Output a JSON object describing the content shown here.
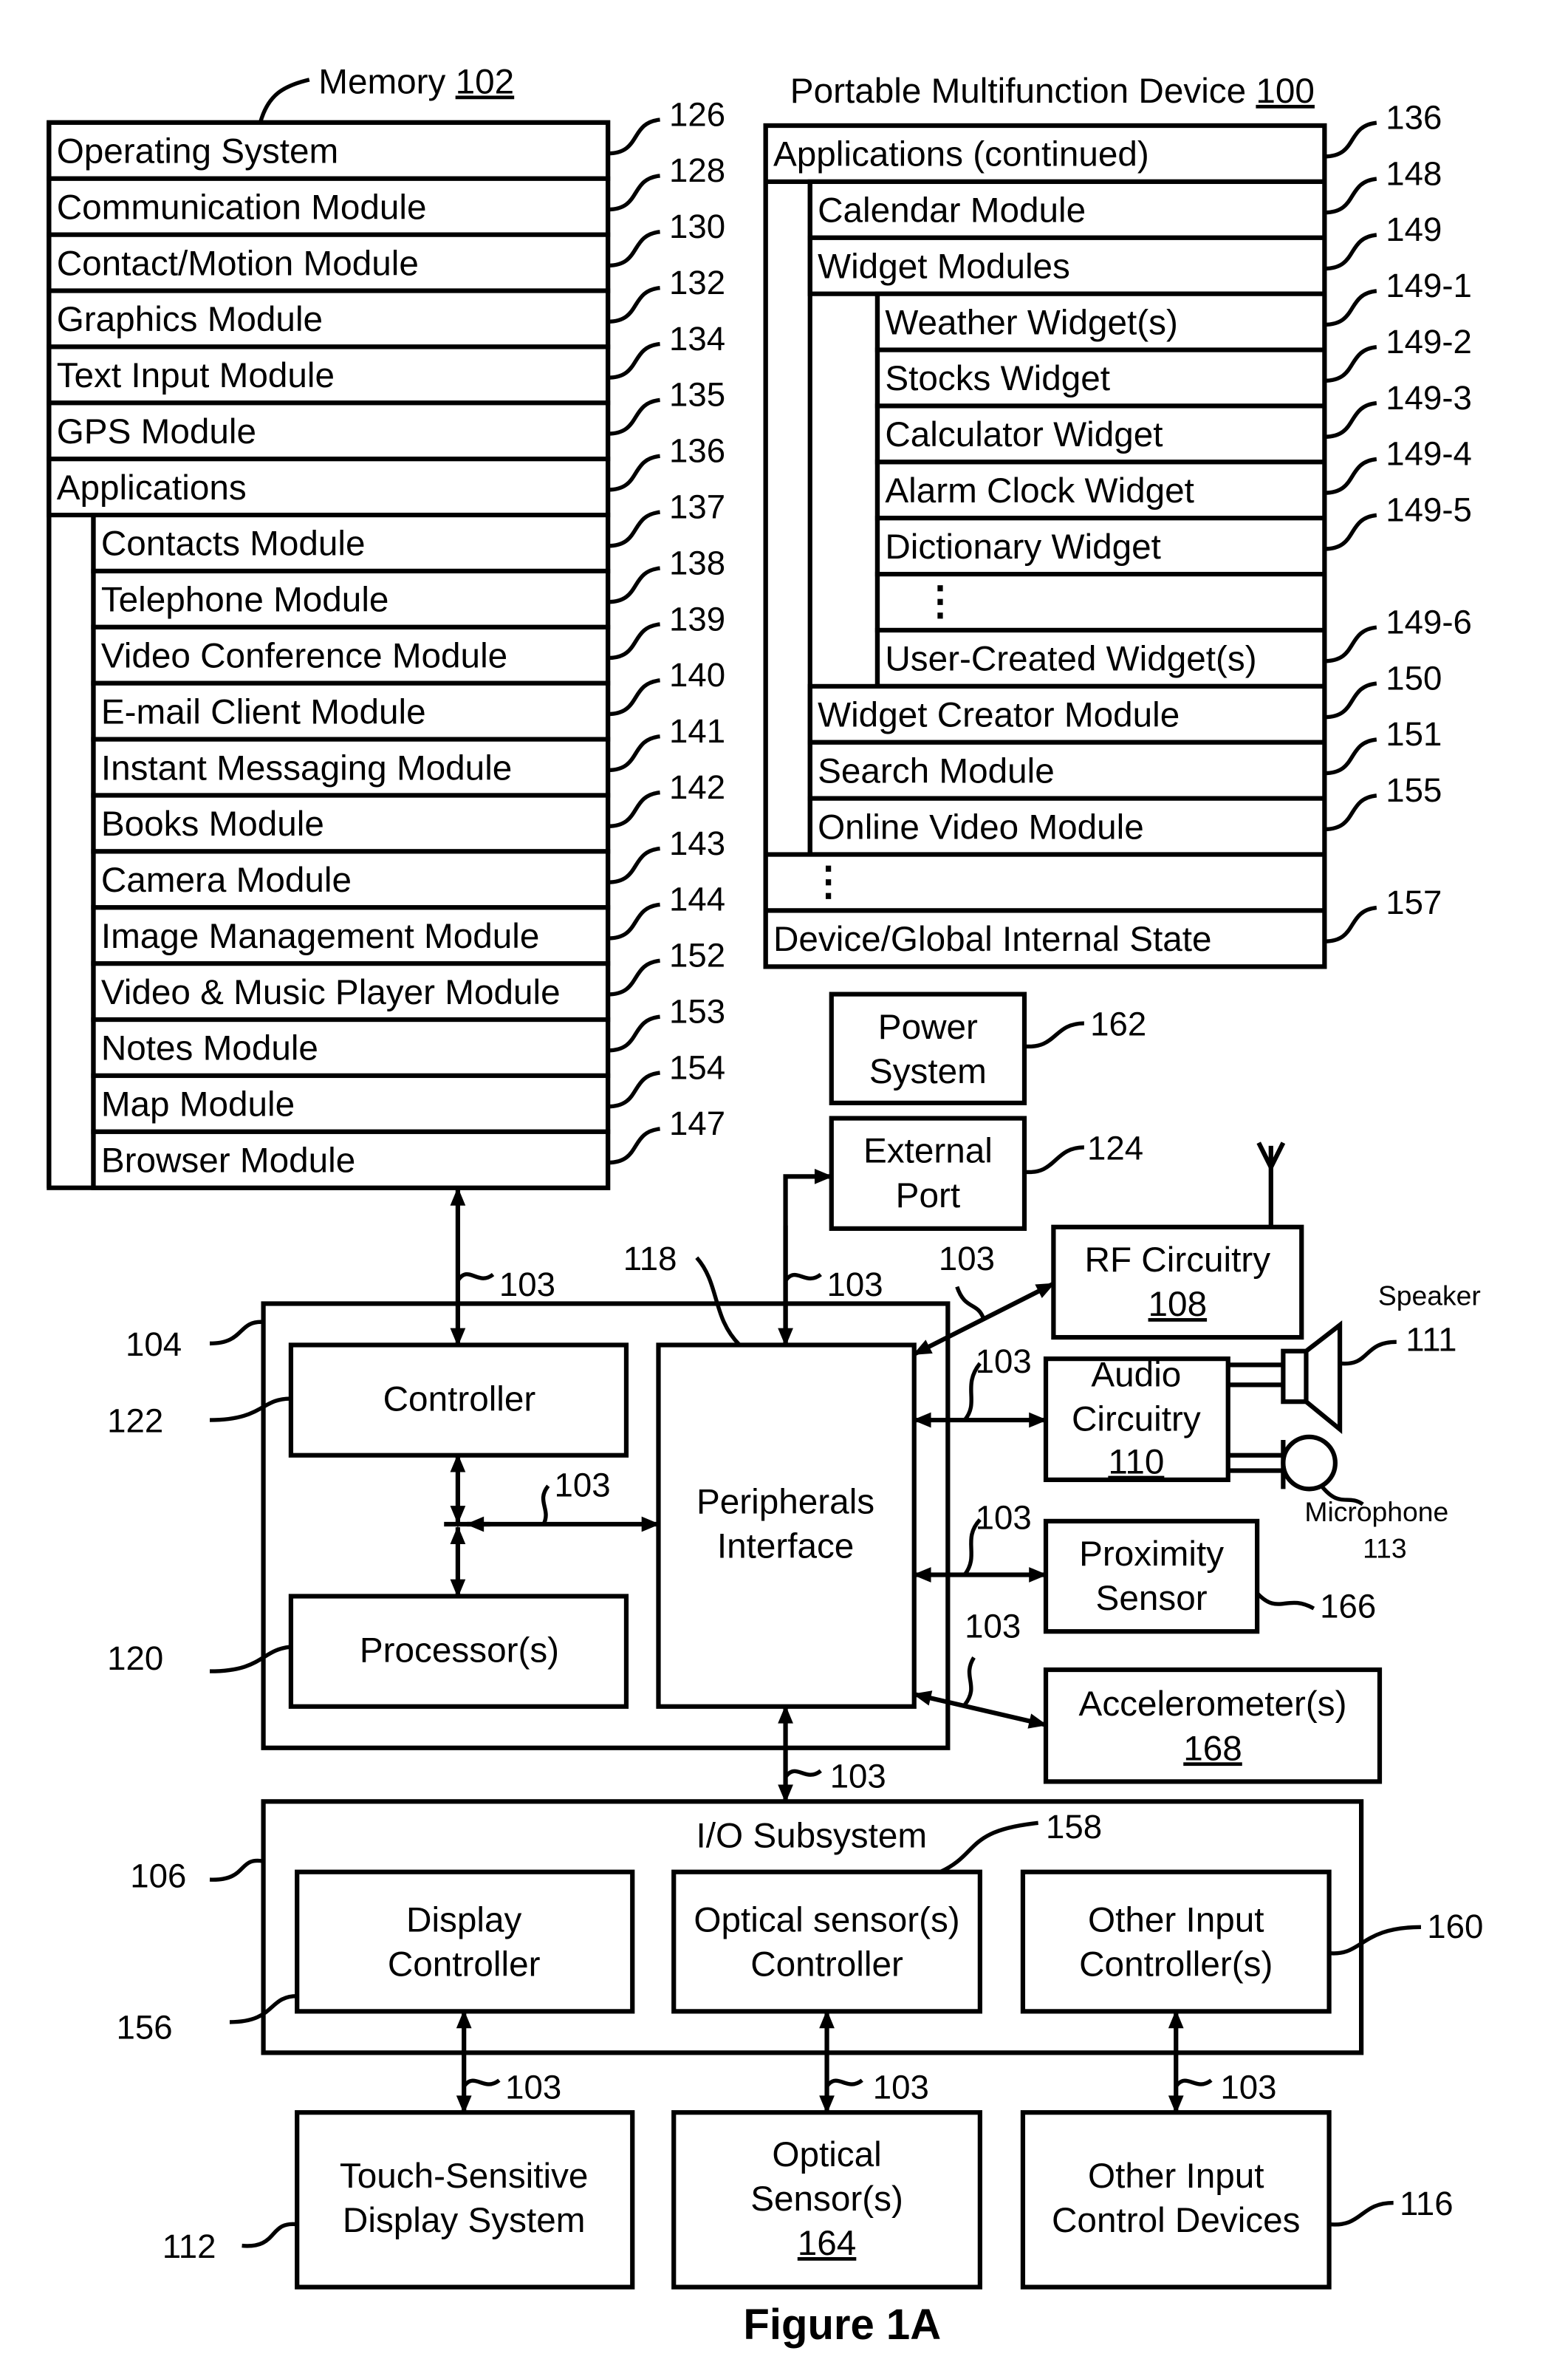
{
  "memory": {
    "title": "Memory",
    "ref": "102",
    "rows": [
      {
        "label": "Operating System",
        "ref": "126",
        "indent": 0
      },
      {
        "label": "Communication Module",
        "ref": "128",
        "indent": 0
      },
      {
        "label": "Contact/Motion Module",
        "ref": "130",
        "indent": 0
      },
      {
        "label": "Graphics Module",
        "ref": "132",
        "indent": 0
      },
      {
        "label": "Text Input Module",
        "ref": "134",
        "indent": 0
      },
      {
        "label": "GPS Module",
        "ref": "135",
        "indent": 0
      },
      {
        "label": "Applications",
        "ref": "136",
        "indent": 0
      },
      {
        "label": "Contacts Module",
        "ref": "137",
        "indent": 1
      },
      {
        "label": "Telephone Module",
        "ref": "138",
        "indent": 1
      },
      {
        "label": "Video Conference Module",
        "ref": "139",
        "indent": 1
      },
      {
        "label": "E-mail Client Module",
        "ref": "140",
        "indent": 1
      },
      {
        "label": "Instant Messaging Module",
        "ref": "141",
        "indent": 1
      },
      {
        "label": "Books Module",
        "ref": "142",
        "indent": 1
      },
      {
        "label": "Camera Module",
        "ref": "143",
        "indent": 1
      },
      {
        "label": "Image Management Module",
        "ref": "144",
        "indent": 1
      },
      {
        "label": "Video & Music Player Module",
        "ref": "152",
        "indent": 1
      },
      {
        "label": "Notes Module",
        "ref": "153",
        "indent": 1
      },
      {
        "label": "Map Module",
        "ref": "154",
        "indent": 1
      },
      {
        "label": "Browser Module",
        "ref": "147",
        "indent": 1
      }
    ]
  },
  "device": {
    "title": "Portable Multifunction Device",
    "ref": "100",
    "rows": [
      {
        "label": "Applications (continued)",
        "ref": "136",
        "indent": 0
      },
      {
        "label": "Calendar Module",
        "ref": "148",
        "indent": 1
      },
      {
        "label": "Widget Modules",
        "ref": "149",
        "indent": 1
      },
      {
        "label": "Weather Widget(s)",
        "ref": "149-1",
        "indent": 2
      },
      {
        "label": "Stocks Widget",
        "ref": "149-2",
        "indent": 2
      },
      {
        "label": "Calculator Widget",
        "ref": "149-3",
        "indent": 2
      },
      {
        "label": "Alarm Clock Widget",
        "ref": "149-4",
        "indent": 2
      },
      {
        "label": "Dictionary Widget",
        "ref": "149-5",
        "indent": 2
      },
      {
        "label": "⋮",
        "ref": "",
        "indent": 2
      },
      {
        "label": "User-Created Widget(s)",
        "ref": "149-6",
        "indent": 2
      },
      {
        "label": "Widget Creator Module",
        "ref": "150",
        "indent": 1
      },
      {
        "label": "Search Module",
        "ref": "151",
        "indent": 1
      },
      {
        "label": "Online Video Module",
        "ref": "155",
        "indent": 1
      },
      {
        "label": "⋮",
        "ref": "",
        "indent": 0
      },
      {
        "label": "Device/Global Internal State",
        "ref": "157",
        "indent": 0
      }
    ]
  },
  "blocks": {
    "power": {
      "lines": [
        "Power",
        "System"
      ],
      "ref": "162"
    },
    "external_port": {
      "lines": [
        "External",
        "Port"
      ],
      "ref": "124"
    },
    "rf": {
      "lines": [
        "RF Circuitry"
      ],
      "ref_underlined": "108"
    },
    "audio": {
      "lines": [
        "Audio",
        "Circuitry"
      ],
      "ref_underlined": "110"
    },
    "proximity": {
      "lines": [
        "Proximity",
        "Sensor"
      ],
      "ref": "166"
    },
    "accelerometer": {
      "lines": [
        "Accelerometer(s)"
      ],
      "ref_underlined": "168"
    },
    "controller": {
      "label": "Controller",
      "ref": "122"
    },
    "processor": {
      "label": "Processor(s)",
      "ref": "120"
    },
    "peripherals": {
      "lines": [
        "Peripherals",
        "Interface"
      ],
      "ref": "118"
    },
    "chip_ref": "104",
    "io": {
      "title": "I/O Subsystem",
      "ref": "106"
    },
    "display_controller": {
      "lines": [
        "Display",
        "Controller"
      ],
      "ref": "156"
    },
    "optical_controller": {
      "lines": [
        "Optical sensor(s)",
        "Controller"
      ],
      "ref": "158"
    },
    "other_input_controller": {
      "lines": [
        "Other Input",
        "Controller(s)"
      ],
      "ref": "160"
    },
    "touch_display": {
      "lines": [
        "Touch-Sensitive",
        "Display System"
      ],
      "ref": "112"
    },
    "optical_sensor": {
      "lines": [
        "Optical",
        "Sensor(s)"
      ],
      "ref_underlined": "164"
    },
    "other_input_devices": {
      "lines": [
        "Other Input",
        "Control Devices"
      ],
      "ref": "116"
    },
    "speaker": {
      "label": "Speaker",
      "ref": "111"
    },
    "microphone": {
      "label": "Microphone",
      "ref": "113"
    },
    "bus_ref": "103"
  },
  "figure_caption": "Figure 1A"
}
